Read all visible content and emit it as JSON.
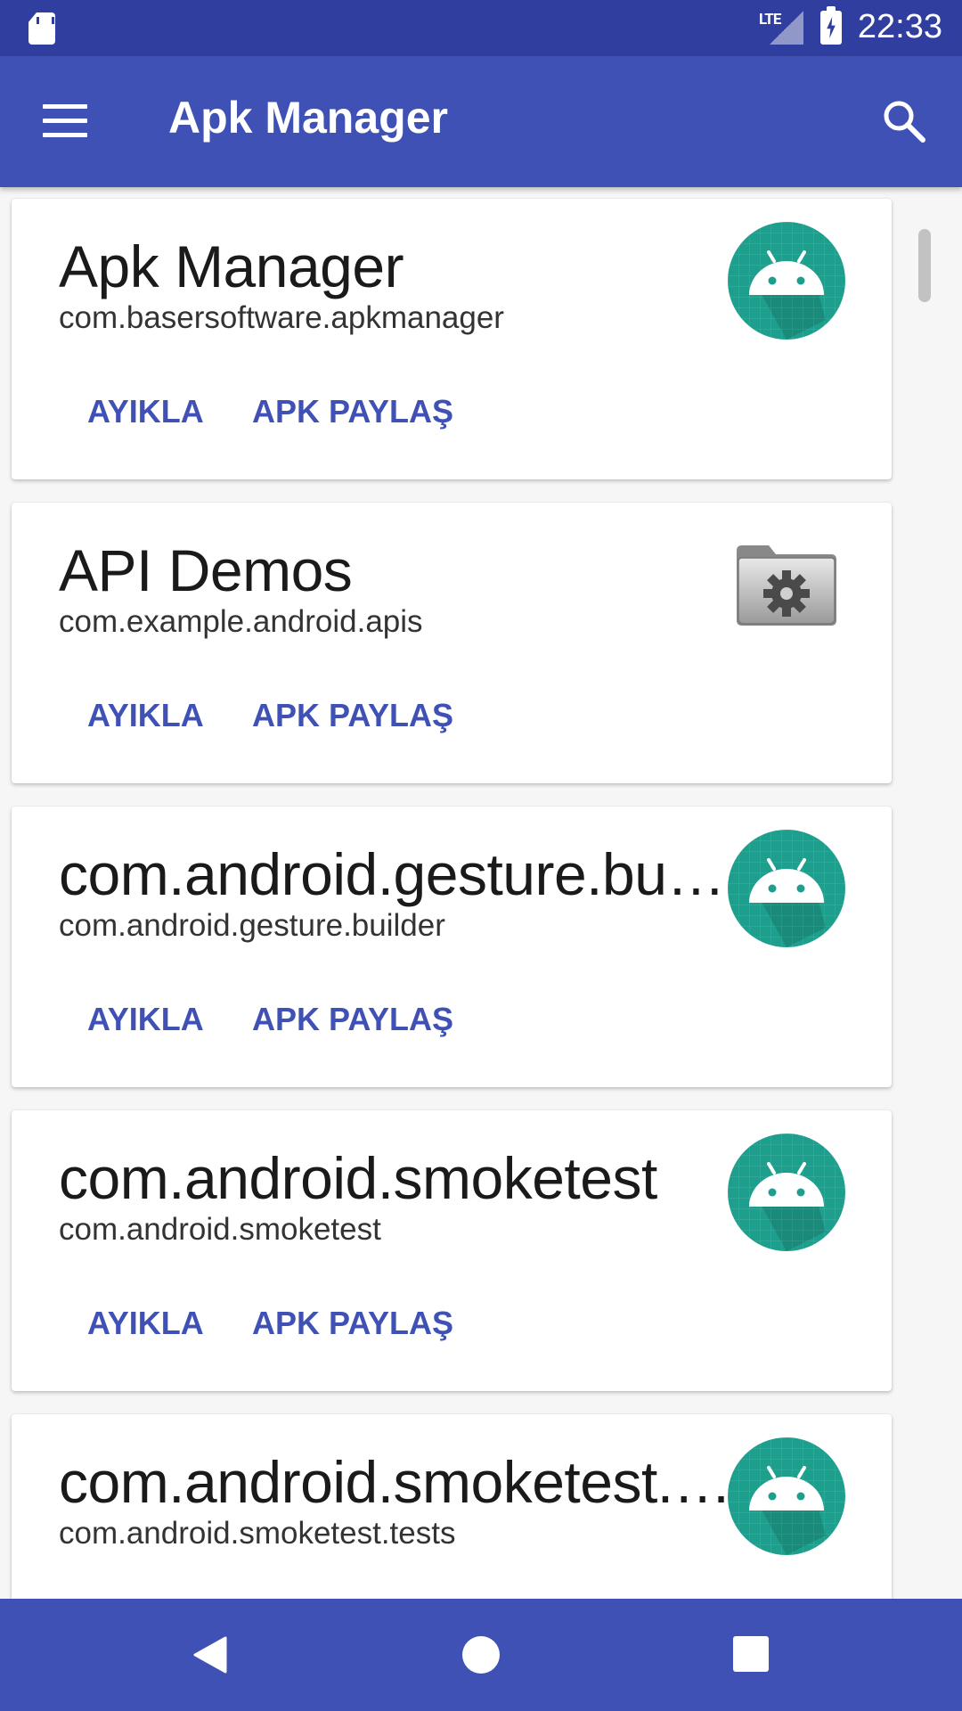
{
  "status_bar": {
    "network": "LTE",
    "time": "22:33"
  },
  "app_bar": {
    "title": "Apk Manager",
    "menu_icon": "hamburger-menu-icon",
    "search_icon": "search-icon"
  },
  "actions": {
    "extract": "AYIKLA",
    "share": "APK PAYLAŞ"
  },
  "apps": [
    {
      "name": "Apk Manager",
      "package": "com.basersoftware.apkmanager",
      "icon": "android-icon"
    },
    {
      "name": "API Demos",
      "package": "com.example.android.apis",
      "icon": "settings-folder-icon"
    },
    {
      "name": "com.android.gesture.builder",
      "package": "com.android.gesture.builder",
      "icon": "android-icon"
    },
    {
      "name": "com.android.smoketest",
      "package": "com.android.smoketest",
      "icon": "android-icon"
    },
    {
      "name": "com.android.smoketest.tests",
      "package": "com.android.smoketest.tests",
      "icon": "android-icon"
    }
  ],
  "colors": {
    "primary": "#3f51b5",
    "primary_dark": "#303f9f",
    "icon_teal": "#1e9e8c"
  },
  "nav_bar": {
    "back_icon": "back-triangle-icon",
    "home_icon": "home-circle-icon",
    "recents_icon": "recents-square-icon"
  }
}
